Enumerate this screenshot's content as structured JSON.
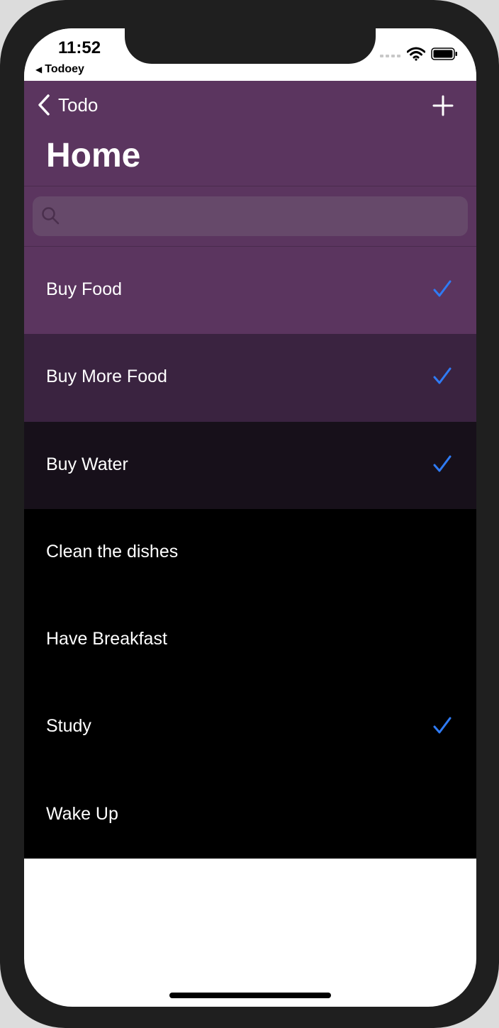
{
  "status_bar": {
    "time": "11:52",
    "back_app": "Todoey"
  },
  "nav": {
    "back_label": "Todo",
    "title": "Home"
  },
  "search": {
    "placeholder": "",
    "value": ""
  },
  "items": [
    {
      "label": "Buy Food",
      "done": true,
      "bg": "#5b355f"
    },
    {
      "label": "Buy More Food",
      "done": true,
      "bg": "#3a2340"
    },
    {
      "label": "Buy Water",
      "done": true,
      "bg": "#17101a"
    },
    {
      "label": "Clean the dishes",
      "done": false,
      "bg": "#000000"
    },
    {
      "label": "Have Breakfast",
      "done": false,
      "bg": "#000000"
    },
    {
      "label": "Study",
      "done": true,
      "bg": "#000000"
    },
    {
      "label": "Wake Up",
      "done": false,
      "bg": "#000000"
    }
  ],
  "colors": {
    "nav_bg": "#5b355f",
    "checkmark": "#2f7bf5"
  }
}
